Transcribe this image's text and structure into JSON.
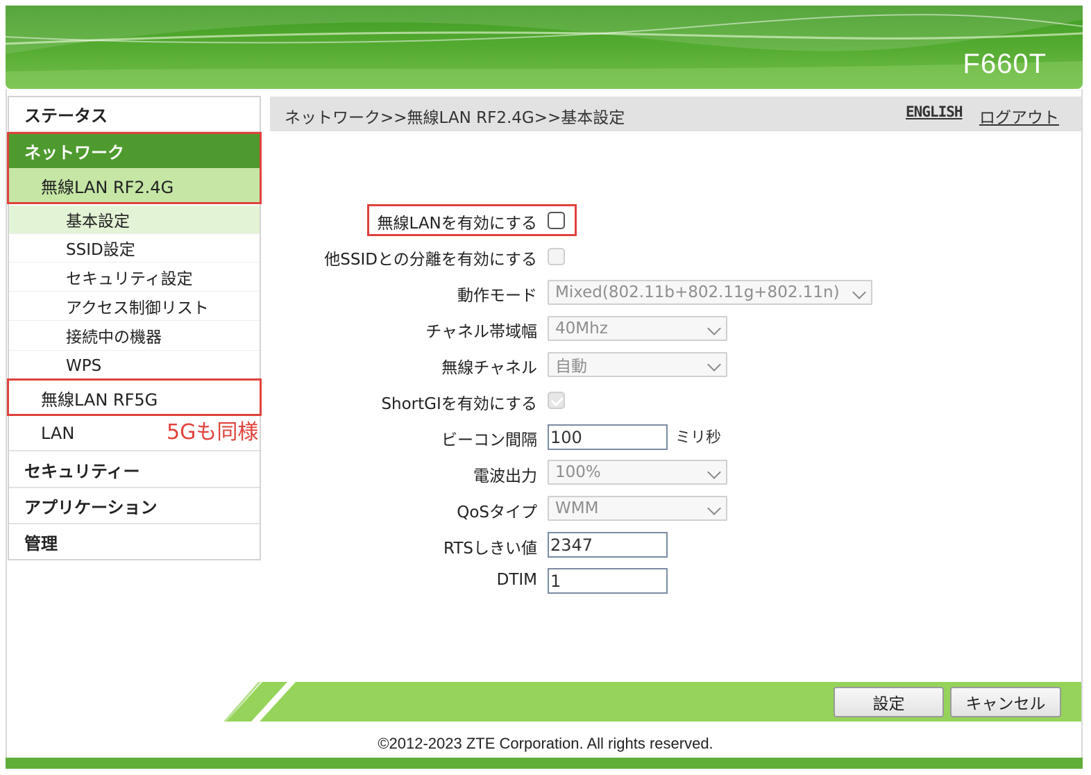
{
  "header": {
    "model": "F660T"
  },
  "sidebar": {
    "status": "ステータス",
    "network": "ネットワーク",
    "wlan24": "無線LAN RF2.4G",
    "sub_items": [
      "基本設定",
      "SSID設定",
      "セキュリティ設定",
      "アクセス制御リスト",
      "接続中の機器",
      "WPS"
    ],
    "wlan5": "無線LAN RF5G",
    "lan": "LAN",
    "security": "セキュリティー",
    "application": "アプリケーション",
    "admin": "管理",
    "note_5g": "5Gも同様"
  },
  "breadcrumb": "ネットワーク>>無線LAN RF2.4G>>基本設定",
  "links": {
    "english": "ENGLISH",
    "logout": "ログアウト"
  },
  "form": {
    "enable_wlan": {
      "label": "無線LANを有効にする",
      "checked": false
    },
    "isolation": {
      "label": "他SSIDとの分離を有効にする",
      "checked": false
    },
    "mode": {
      "label": "動作モード",
      "value": "Mixed(802.11b+802.11g+802.11n)"
    },
    "bandwidth": {
      "label": "チャネル帯域幅",
      "value": "40Mhz"
    },
    "channel": {
      "label": "無線チャネル",
      "value": "自動"
    },
    "shortgi": {
      "label": "ShortGIを有効にする",
      "checked": true
    },
    "beacon": {
      "label": "ビーコン間隔",
      "value": "100",
      "unit": "ミリ秒"
    },
    "power": {
      "label": "電波出力",
      "value": "100%"
    },
    "qos": {
      "label": "QoSタイプ",
      "value": "WMM"
    },
    "rts": {
      "label": "RTSしきい値",
      "value": "2347"
    },
    "dtim": {
      "label": "DTIM",
      "value": "1"
    }
  },
  "buttons": {
    "apply": "設定",
    "cancel": "キャンセル"
  },
  "footer": {
    "copyright": "©2012-2023 ZTE Corporation. All rights reserved."
  },
  "colors": {
    "brand_green": "#5fae37",
    "menu_active": "#4f9a2f",
    "menu_sub_active": "#c5e6a5",
    "highlight_red": "#e0413b"
  }
}
